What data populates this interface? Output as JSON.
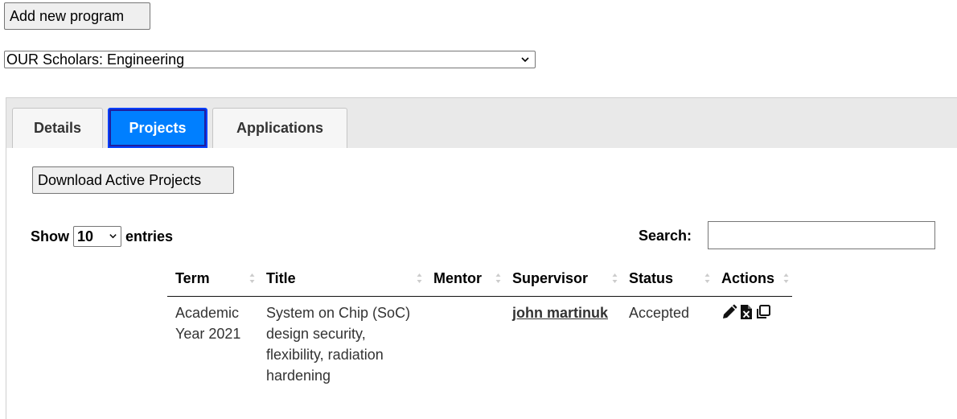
{
  "toolbar": {
    "add_label": "Add new program"
  },
  "program_select": {
    "value": "OUR Scholars: Engineering"
  },
  "tabs": [
    {
      "label": "Details",
      "active": false
    },
    {
      "label": "Projects",
      "active": true
    },
    {
      "label": "Applications",
      "active": false
    }
  ],
  "projects": {
    "download_label": "Download Active Projects",
    "show_label": "Show",
    "entries_value": "10",
    "entries_label": "entries",
    "search_label": "Search:",
    "search_value": "",
    "columns": [
      "Term",
      "Title",
      "Mentor",
      "Supervisor",
      "Status",
      "Actions"
    ],
    "rows": [
      {
        "term": "Academic Year 2021",
        "title": "System on Chip (SoC) design security, flexibility, radiation hardening",
        "mentor": "",
        "supervisor": "john martinuk",
        "status": "Accepted",
        "actions": [
          "pencil-icon",
          "file-excel-icon",
          "copy-icon"
        ]
      }
    ]
  },
  "colors": {
    "active_tab": "#007fff",
    "active_tab_border": "#003eff",
    "tab_bar": "#e9e9e9"
  }
}
